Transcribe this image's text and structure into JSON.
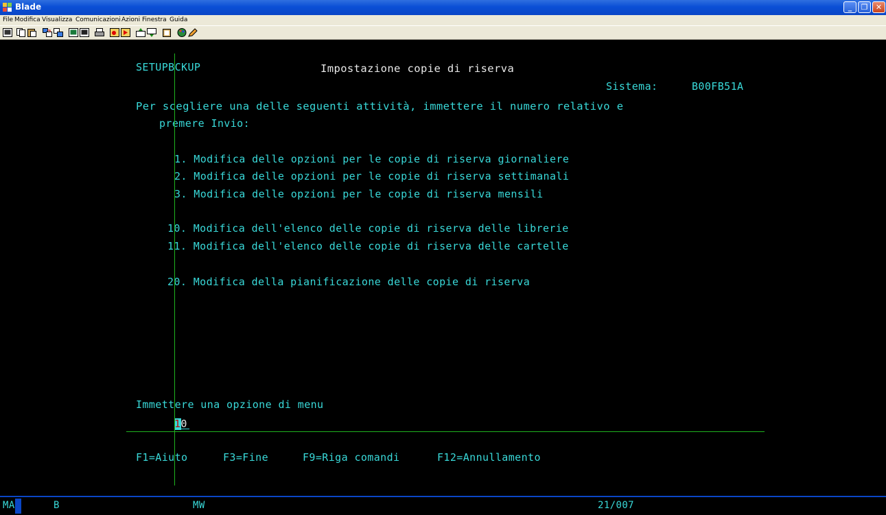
{
  "window": {
    "title": "Blade",
    "minimize_label": "_",
    "maximize_label": "❐",
    "close_label": "✕"
  },
  "menu": {
    "items": [
      "File",
      "Modifica",
      "Visualizza",
      "Comunicazioni",
      "Azioni",
      "Finestra",
      "Guida"
    ]
  },
  "toolbar": {
    "icons": [
      "screen-icon",
      "copy-icon",
      "paste-icon",
      "send-icon",
      "receive-icon",
      "display-icon",
      "display2-icon",
      "print-icon",
      "macro-record-icon",
      "macro-play-icon",
      "transfer-up-icon",
      "transfer-down-icon",
      "clipboard-icon",
      "color-palette-icon",
      "edit-icon"
    ]
  },
  "screen": {
    "program_name": "SETUPBCKUP",
    "screen_title": "Impostazione copie di riserva",
    "system_label": "Sistema:",
    "system_value": "B00FB51A",
    "instruction_line1": "Per scegliere una delle seguenti attività, immettere il numero relativo e",
    "instruction_line2": "premere Invio:",
    "options": [
      "1. Modifica delle opzioni per le copie di riserva giornaliere",
      "2. Modifica delle opzioni per le copie di riserva settimanali",
      "3. Modifica delle opzioni per le copie di riserva mensili",
      "10. Modifica dell'elenco delle copie di riserva delle librerie",
      "11. Modifica dell'elenco delle copie di riserva delle cartelle",
      "20. Modifica della pianificazione delle copie di riserva"
    ],
    "prompt": "Immettere una opzione di menu",
    "input_value": "10",
    "function_keys": [
      "F1=Aiuto",
      "F3=Fine",
      "F9=Riga comandi",
      "F12=Annullamento"
    ]
  },
  "status": {
    "mode": "MA",
    "indicator_b": "B",
    "indicator_mw": "MW",
    "cursor_position": "21/007"
  },
  "colors": {
    "screen_background": "#000000",
    "text_cyan": "#39d9d9",
    "text_white": "#e9e9e9",
    "crosshair_green": "#1fb51f",
    "titlebar_blue": "#0a46c6"
  }
}
